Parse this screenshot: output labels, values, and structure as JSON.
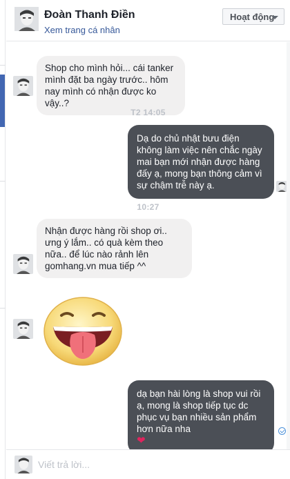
{
  "header": {
    "name": "Đoàn Thanh Điền",
    "profile_link": "Xem trang cá nhân",
    "status_button": "Hoạt động"
  },
  "messages": [
    {
      "from": "customer",
      "text": "Shop cho mình hỏi... cái tanker mình đặt ba ngày trước.. hôm nay mình có nhận được ko vậy..?"
    },
    {
      "type": "timestamp",
      "text": "T2 14:05"
    },
    {
      "from": "shop",
      "text": "Dạ do chủ nhật bưu điện không làm việc nên chắc ngày mai bạn mới nhận được hàng đấy ạ, mong bạn thông cảm vì sự chậm trễ này ạ."
    },
    {
      "type": "timestamp",
      "text": "10:27"
    },
    {
      "from": "customer",
      "text": "Nhận được hàng rồi shop ơi.. ưng ý lắm.. có quà kèm theo nữa.. để lúc nào rảnh lên gomhang.vn mua tiếp ^^"
    },
    {
      "from": "customer",
      "type": "sticker",
      "sticker": "tongue-out-smiley"
    },
    {
      "from": "shop",
      "text": "dạ bạn hài lòng là shop vui rồi ạ, mong là shop tiếp tục dc phục vụ bạn nhiều sản phẩm hơn nữa nha",
      "emoji": "❤"
    }
  ],
  "composer": {
    "placeholder": "Viết trả lời..."
  },
  "colors": {
    "outgoing_bubble": "#4b4f56",
    "incoming_bubble": "#f1f0f0",
    "link": "#365899",
    "heart": "#e0245e",
    "seen_check": "#4a90d9"
  },
  "icons": [
    "avatar",
    "chevron-down-icon",
    "seen-check-icon",
    "heart-icon",
    "sticker-tongue-smiley"
  ]
}
